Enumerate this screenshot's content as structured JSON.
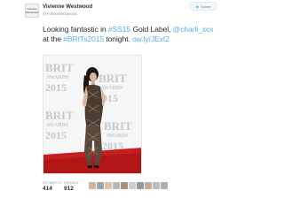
{
  "header": {
    "avatar_text": "Vivienne Westwood",
    "name": "Vivienne Westwood",
    "handle": "@FollowWestwood",
    "follow_label": "Suivre"
  },
  "tweet": {
    "text_parts": [
      {
        "text": "Looking fantastic in ",
        "link": false
      },
      {
        "text": "#SS15",
        "link": true
      },
      {
        "text": " Gold Label, ",
        "link": false
      },
      {
        "text": "@charli_xcx",
        "link": true
      },
      {
        "text": " at the ",
        "link": false
      },
      {
        "text": "#BRITs2015",
        "link": true
      },
      {
        "text": " tonight. ",
        "link": false
      },
      {
        "text": "ow.ly/JExt2",
        "link": true
      }
    ]
  },
  "photo": {
    "backdrop_text": [
      "BRIT",
      "AWARDS",
      "2015"
    ]
  },
  "stats": {
    "retweets_label": "RETWEETS",
    "retweets_value": "414",
    "favorites_label": "FAVORIS",
    "favorites_value": "912"
  }
}
